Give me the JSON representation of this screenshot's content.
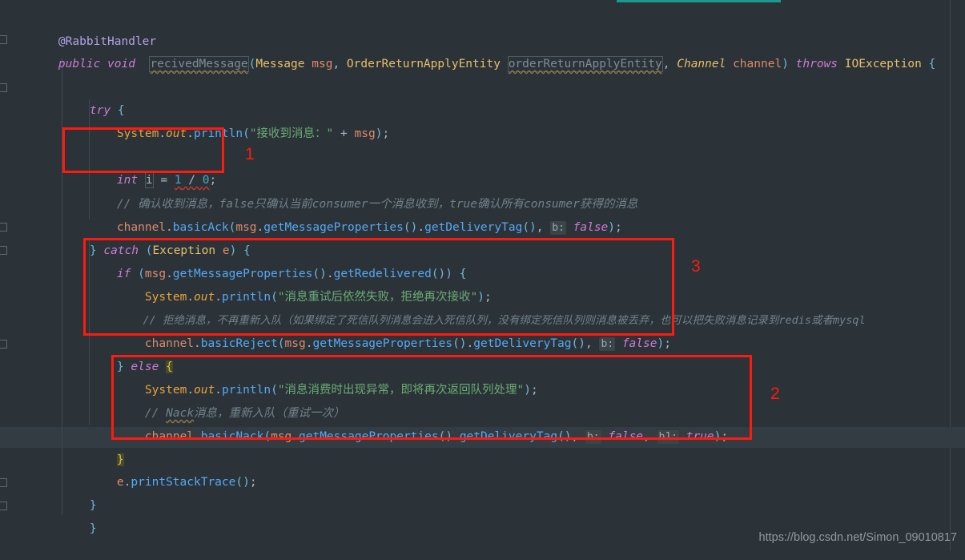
{
  "editor": {
    "theme_bg": "#2b3338",
    "accent_teal": "#1a9a90",
    "annotation_color": "#ff1a0f",
    "code": {
      "line_annotation": "@RabbitHandler",
      "signature": {
        "modifiers": "public void",
        "method_name": "recivedMessage",
        "param1_type": "Message",
        "param1_name": "msg",
        "param2_type": "OrderReturnApplyEntity",
        "param2_name": "orderReturnApplyEntity",
        "param3_type": "Channel",
        "param3_name": "channel",
        "throws_kw": "throws",
        "throws_type": "IOException"
      },
      "try_kw": "try",
      "println_1": "System.out.println(\"接收到消息：\" + msg);",
      "divide_by_zero": "int i = 1 / 0;",
      "comment_ack": "// 确认收到消息，false只确认当前consumer一个消息收到，true确认所有consumer获得的消息",
      "basic_ack": "channel.basicAck(msg.getMessageProperties().getDeliveryTag(), b: false);",
      "catch_line": "} catch (Exception e) {",
      "if_line": "if (msg.getMessageProperties().getRedelivered()) {",
      "println_reject": "System.out.println(\"消息重试后依然失败，拒绝再次接收\");",
      "comment_reject": "// 拒绝消息，不再重新入队（如果绑定了死信队列消息会进入死信队列，没有绑定死信队列则消息被丢弃，也可以把失败消息记录到redis或者mysql",
      "basic_reject": "channel.basicReject(msg.getMessageProperties().getDeliveryTag(), b: false);",
      "else_line": "} else {",
      "println_nack": "System.out.println(\"消息消费时出现异常，即将再次返回队列处理\");",
      "comment_nack": "// Nack消息，重新入队（重试一次）",
      "basic_nack": "channel.basicNack(msg.getMessageProperties().getDeliveryTag(), b: false, b1: true);",
      "close_else": "}",
      "print_stack_trace": "e.printStackTrace();",
      "close_catch": "}",
      "close_method": "}"
    },
    "tokens": {
      "at_rabbit_handler": "@RabbitHandler",
      "public": "public",
      "void": "void",
      "recived_message": "recivedMessage",
      "message_type": "Message",
      "msg": "msg",
      "order_return_apply_entity_type": "OrderReturnApplyEntity",
      "order_return_apply_entity_var": "orderReturnApplyEntity",
      "channel_type": "Channel",
      "channel_var": "channel",
      "throws": "throws",
      "io_exception": "IOException",
      "try": "try",
      "catch": "catch",
      "exception": "Exception",
      "e": "e",
      "if": "if",
      "else": "else",
      "int": "int",
      "i": "i",
      "system": "System",
      "out": "out",
      "println": "println",
      "basic_ack": "basicAck",
      "basic_reject": "basicReject",
      "basic_nack": "basicNack",
      "get_message_properties": "getMessageProperties",
      "get_delivery_tag": "getDeliveryTag",
      "get_redelivered": "getRedelivered",
      "print_stack_trace": "printStackTrace",
      "nack": "Nack",
      "true": "true",
      "false": "false",
      "one": "1",
      "zero": "0",
      "hint_b": "b:",
      "hint_b1": "b1:",
      "str_received": "\"接收到消息：\"",
      "str_retry_failed": "\"消息重试后依然失败，拒绝再次接收\"",
      "str_consume_error": "\"消息消费时出现异常，即将再次返回队列处理\""
    },
    "annotations": [
      {
        "label": "1",
        "target": "divide-by-zero-line"
      },
      {
        "label": "2",
        "target": "basic-nack-block"
      },
      {
        "label": "3",
        "target": "redelivered-if-block"
      }
    ],
    "watermark": "https://blog.csdn.net/Simon_09010817"
  }
}
